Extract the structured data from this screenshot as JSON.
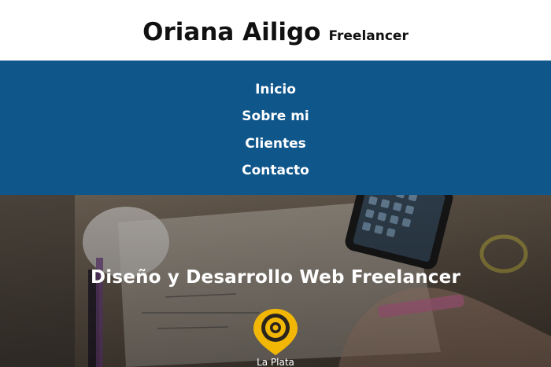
{
  "header": {
    "name": "Oriana Ailigo",
    "tagline": "Freelancer"
  },
  "nav": {
    "items": [
      {
        "label": "Inicio"
      },
      {
        "label": "Sobre mi"
      },
      {
        "label": "Clientes"
      },
      {
        "label": "Contacto"
      }
    ]
  },
  "hero": {
    "title": "Diseño y Desarrollo Web Freelancer",
    "location": "La Plata",
    "icon": "location-pin-icon"
  },
  "colors": {
    "nav_background": "#0f568b",
    "pin_accent": "#f2b705",
    "text_light": "#ffffff",
    "text_dark": "#111111"
  }
}
